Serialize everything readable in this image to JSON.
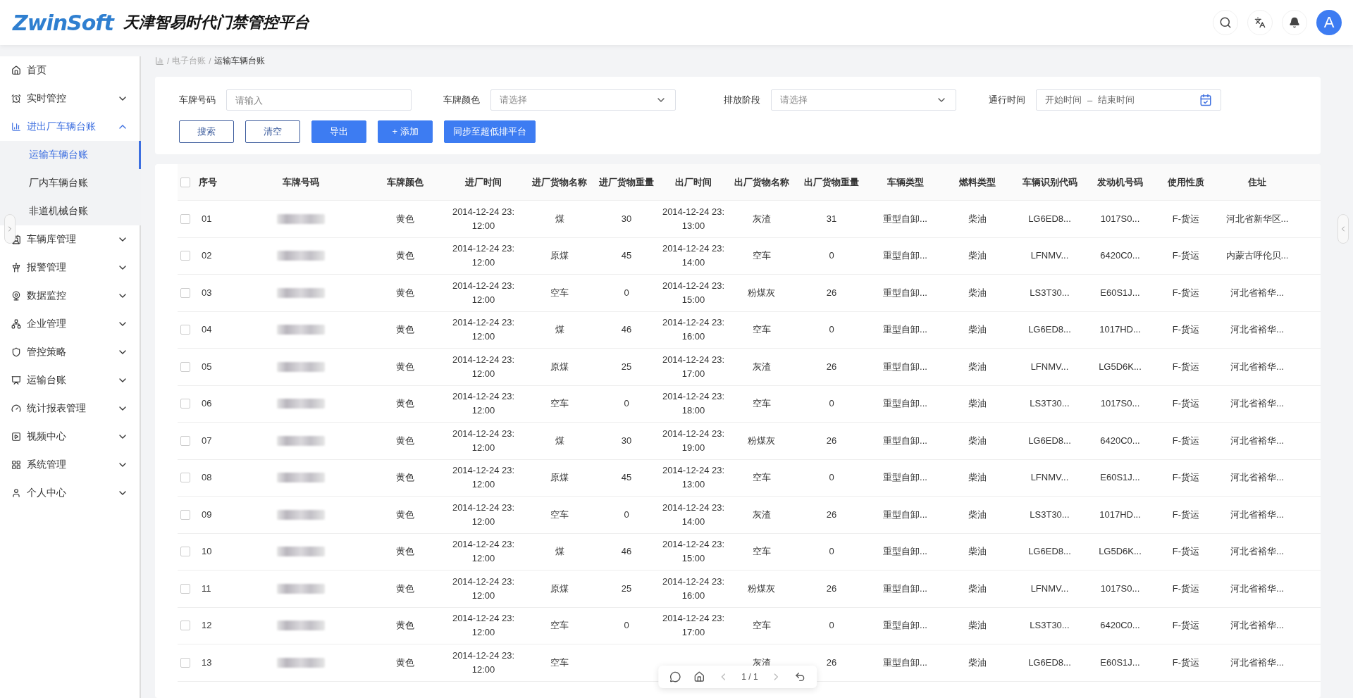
{
  "header": {
    "logo": "ZwinSoft",
    "title": "天津智易时代门禁管控平台",
    "avatar": "A"
  },
  "sidebar": {
    "items": [
      {
        "label": "首页",
        "selected": false
      },
      {
        "label": "实时管控",
        "selected": false,
        "expanded": false
      },
      {
        "label": "进出厂车辆台账",
        "selected": true,
        "expanded": true,
        "children": [
          {
            "label": "运输车辆台账",
            "selected": true
          },
          {
            "label": "厂内车辆台账",
            "selected": false
          },
          {
            "label": "非道机械台账",
            "selected": false
          }
        ]
      },
      {
        "label": "车辆库管理",
        "selected": false,
        "expanded": false
      },
      {
        "label": "报警管理",
        "selected": false,
        "expanded": false
      },
      {
        "label": "数据监控",
        "selected": false,
        "expanded": false
      },
      {
        "label": "企业管理",
        "selected": false,
        "expanded": false
      },
      {
        "label": "管控策略",
        "selected": false,
        "expanded": false
      },
      {
        "label": "运输台账",
        "selected": false,
        "expanded": false
      },
      {
        "label": "统计报表管理",
        "selected": false,
        "expanded": false
      },
      {
        "label": "视频中心",
        "selected": false,
        "expanded": false
      },
      {
        "label": "系统管理",
        "selected": false,
        "expanded": false
      },
      {
        "label": "个人中心",
        "selected": false,
        "expanded": false
      }
    ]
  },
  "breadcrumb": [
    "/",
    "电子台账",
    "/",
    "运输车辆台账"
  ],
  "filters": [
    {
      "kind": "input",
      "label": "车牌号码",
      "placeholder": "请输入"
    },
    {
      "kind": "select",
      "label": "车牌颜色",
      "placeholder": "请选择"
    },
    {
      "kind": "select",
      "label": "排放阶段",
      "placeholder": "请选择"
    },
    {
      "kind": "daterange",
      "label": "通行时间",
      "start_placeholder": "开始时间",
      "separator": "–",
      "end_placeholder": "结束时间"
    }
  ],
  "buttons": [
    {
      "label": "搜索",
      "kind": "outline"
    },
    {
      "label": "清空",
      "kind": "outline"
    },
    {
      "label": "导出",
      "kind": "primary"
    },
    {
      "label": "+ 添加",
      "kind": "primary"
    },
    {
      "label": "同步至超低排平台",
      "kind": "primary"
    }
  ],
  "table": {
    "all_checked": false,
    "columns": [
      "序号",
      "车牌号码",
      "车牌颜色",
      "进厂时间",
      "进厂货物名称",
      "进厂货物重量",
      "出厂时间",
      "出厂货物名称",
      "出厂货物重量",
      "车辆类型",
      "燃料类型",
      "车辆识别代码",
      "发动机号码",
      "使用性质",
      "住址"
    ],
    "rows": [
      {
        "checked": false,
        "cells": [
          "01",
          null,
          "黄色",
          [
            "2014-12-24  23:",
            "12:00"
          ],
          "煤",
          "30",
          [
            "2014-12-24  23:",
            "13:00"
          ],
          "灰渣",
          "31",
          "重型自卸...",
          "柴油",
          "LG6ED8...",
          "1017S0...",
          "F-货运",
          "河北省新华区..."
        ]
      },
      {
        "checked": false,
        "cells": [
          "02",
          null,
          "黄色",
          [
            "2014-12-24  23:",
            "12:00"
          ],
          "原煤",
          "45",
          [
            "2014-12-24  23:",
            "14:00"
          ],
          "空车",
          "0",
          "重型自卸...",
          "柴油",
          "LFNMV...",
          "6420C0...",
          "F-货运",
          "内蒙古呼伦贝..."
        ]
      },
      {
        "checked": false,
        "cells": [
          "03",
          null,
          "黄色",
          [
            "2014-12-24  23:",
            "12:00"
          ],
          "空车",
          "0",
          [
            "2014-12-24  23:",
            "15:00"
          ],
          "粉煤灰",
          "26",
          "重型自卸...",
          "柴油",
          "LS3T30...",
          "E60S1J...",
          "F-货运",
          "河北省裕华..."
        ]
      },
      {
        "checked": false,
        "cells": [
          "04",
          null,
          "黄色",
          [
            "2014-12-24  23:",
            "12:00"
          ],
          "煤",
          "46",
          [
            "2014-12-24  23:",
            "16:00"
          ],
          "空车",
          "0",
          "重型自卸...",
          "柴油",
          "LG6ED8...",
          "1017HD...",
          "F-货运",
          "河北省裕华..."
        ]
      },
      {
        "checked": false,
        "cells": [
          "05",
          null,
          "黄色",
          [
            "2014-12-24  23:",
            "12:00"
          ],
          "原煤",
          "25",
          [
            "2014-12-24  23:",
            "17:00"
          ],
          "灰渣",
          "26",
          "重型自卸...",
          "柴油",
          "LFNMV...",
          "LG5D6K...",
          "F-货运",
          "河北省裕华..."
        ]
      },
      {
        "checked": false,
        "cells": [
          "06",
          null,
          "黄色",
          [
            "2014-12-24  23:",
            "12:00"
          ],
          "空车",
          "0",
          [
            "2014-12-24  23:",
            "18:00"
          ],
          "空车",
          "0",
          "重型自卸...",
          "柴油",
          "LS3T30...",
          "1017S0...",
          "F-货运",
          "河北省裕华..."
        ]
      },
      {
        "checked": false,
        "cells": [
          "07",
          null,
          "黄色",
          [
            "2014-12-24  23:",
            "12:00"
          ],
          "煤",
          "30",
          [
            "2014-12-24  23:",
            "19:00"
          ],
          "粉煤灰",
          "26",
          "重型自卸...",
          "柴油",
          "LG6ED8...",
          "6420C0...",
          "F-货运",
          "河北省裕华..."
        ]
      },
      {
        "checked": false,
        "cells": [
          "08",
          null,
          "黄色",
          [
            "2014-12-24  23:",
            "12:00"
          ],
          "原煤",
          "45",
          [
            "2014-12-24  23:",
            "13:00"
          ],
          "空车",
          "0",
          "重型自卸...",
          "柴油",
          "LFNMV...",
          "E60S1J...",
          "F-货运",
          "河北省裕华..."
        ]
      },
      {
        "checked": false,
        "cells": [
          "09",
          null,
          "黄色",
          [
            "2014-12-24  23:",
            "12:00"
          ],
          "空车",
          "0",
          [
            "2014-12-24  23:",
            "14:00"
          ],
          "灰渣",
          "26",
          "重型自卸...",
          "柴油",
          "LS3T30...",
          "1017HD...",
          "F-货运",
          "河北省裕华..."
        ]
      },
      {
        "checked": false,
        "cells": [
          "10",
          null,
          "黄色",
          [
            "2014-12-24  23:",
            "12:00"
          ],
          "煤",
          "46",
          [
            "2014-12-24  23:",
            "15:00"
          ],
          "空车",
          "0",
          "重型自卸...",
          "柴油",
          "LG6ED8...",
          "LG5D6K...",
          "F-货运",
          "河北省裕华..."
        ]
      },
      {
        "checked": false,
        "cells": [
          "11",
          null,
          "黄色",
          [
            "2014-12-24  23:",
            "12:00"
          ],
          "原煤",
          "25",
          [
            "2014-12-24  23:",
            "16:00"
          ],
          "粉煤灰",
          "26",
          "重型自卸...",
          "柴油",
          "LFNMV...",
          "1017S0...",
          "F-货运",
          "河北省裕华..."
        ]
      },
      {
        "checked": false,
        "cells": [
          "12",
          null,
          "黄色",
          [
            "2014-12-24  23:",
            "12:00"
          ],
          "空车",
          "0",
          [
            "2014-12-24  23:",
            "17:00"
          ],
          "空车",
          "0",
          "重型自卸...",
          "柴油",
          "LS3T30...",
          "6420C0...",
          "F-货运",
          "河北省裕华..."
        ]
      },
      {
        "checked": false,
        "cells": [
          "13",
          null,
          "黄色",
          [
            "2014-12-24  23:",
            "12:00"
          ],
          "空车",
          null,
          null,
          "灰渣",
          "26",
          "重型自卸...",
          "柴油",
          "LG6ED8...",
          "E60S1J...",
          "F-货运",
          "河北省裕华..."
        ]
      }
    ]
  },
  "pager": {
    "page": "1 / 1"
  }
}
